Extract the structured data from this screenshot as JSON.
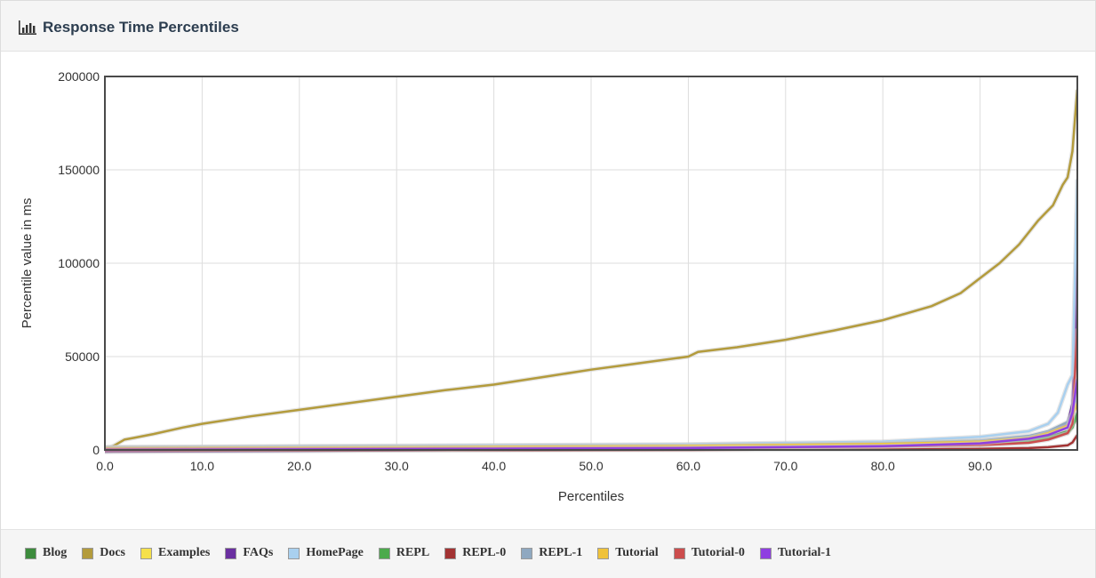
{
  "panel": {
    "title": "Response Time Percentiles",
    "icon": "bar-chart-icon"
  },
  "chart_data": {
    "type": "line",
    "xlabel": "Percentiles",
    "ylabel": "Percentile value in ms",
    "xlim": [
      0,
      100
    ],
    "ylim": [
      0,
      200000
    ],
    "x_ticks": [
      "0.0",
      "10.0",
      "20.0",
      "30.0",
      "40.0",
      "50.0",
      "60.0",
      "70.0",
      "80.0",
      "90.0"
    ],
    "y_ticks": [
      "0",
      "50000",
      "100000",
      "150000",
      "200000"
    ],
    "grid": true,
    "legend_position": "bottom",
    "series": [
      {
        "name": "Blog",
        "color": "#3d8b3d",
        "points": [
          [
            0,
            1000
          ],
          [
            20,
            1200
          ],
          [
            40,
            1500
          ],
          [
            60,
            1800
          ],
          [
            80,
            2500
          ],
          [
            90,
            3500
          ],
          [
            95,
            5000
          ],
          [
            97,
            7000
          ],
          [
            99,
            10000
          ],
          [
            99.5,
            13000
          ],
          [
            100,
            17000
          ]
        ]
      },
      {
        "name": "Docs",
        "color": "#b39b3c",
        "points": [
          [
            0,
            0
          ],
          [
            1,
            2500
          ],
          [
            2,
            5500
          ],
          [
            3,
            6500
          ],
          [
            5,
            8500
          ],
          [
            8,
            12000
          ],
          [
            10,
            14000
          ],
          [
            15,
            18000
          ],
          [
            20,
            21500
          ],
          [
            25,
            25000
          ],
          [
            30,
            28500
          ],
          [
            35,
            32000
          ],
          [
            40,
            35000
          ],
          [
            45,
            39000
          ],
          [
            50,
            43000
          ],
          [
            55,
            46500
          ],
          [
            60,
            50000
          ],
          [
            61,
            52500
          ],
          [
            65,
            55000
          ],
          [
            70,
            59000
          ],
          [
            75,
            64000
          ],
          [
            80,
            69500
          ],
          [
            85,
            77000
          ],
          [
            88,
            84000
          ],
          [
            90,
            92000
          ],
          [
            92,
            100000
          ],
          [
            94,
            110000
          ],
          [
            96,
            123000
          ],
          [
            97.5,
            131000
          ],
          [
            98.5,
            142000
          ],
          [
            99,
            146000
          ],
          [
            99.5,
            160000
          ],
          [
            99.8,
            180000
          ],
          [
            100,
            193000
          ]
        ]
      },
      {
        "name": "Examples",
        "color": "#f5e04a",
        "points": [
          [
            0,
            1500
          ],
          [
            20,
            1800
          ],
          [
            40,
            2200
          ],
          [
            60,
            2700
          ],
          [
            80,
            3800
          ],
          [
            90,
            5000
          ],
          [
            95,
            7000
          ],
          [
            97,
            9000
          ],
          [
            99,
            14000
          ],
          [
            99.5,
            20000
          ],
          [
            100,
            28000
          ]
        ]
      },
      {
        "name": "FAQs",
        "color": "#6a2fa0",
        "points": [
          [
            0,
            -1000
          ],
          [
            20,
            -500
          ],
          [
            40,
            0
          ],
          [
            60,
            500
          ],
          [
            70,
            1500
          ],
          [
            80,
            2500
          ],
          [
            90,
            4500
          ],
          [
            95,
            7000
          ],
          [
            97,
            9000
          ],
          [
            99,
            14000
          ],
          [
            99.5,
            25000
          ],
          [
            99.8,
            60000
          ],
          [
            100,
            127000
          ]
        ]
      },
      {
        "name": "HomePage",
        "color": "#a9d0ef",
        "points": [
          [
            0,
            1500
          ],
          [
            20,
            2000
          ],
          [
            40,
            2500
          ],
          [
            60,
            3000
          ],
          [
            80,
            4500
          ],
          [
            90,
            7000
          ],
          [
            95,
            10000
          ],
          [
            97,
            14000
          ],
          [
            98,
            20000
          ],
          [
            99,
            35000
          ],
          [
            99.5,
            40000
          ],
          [
            100,
            145000
          ]
        ]
      },
      {
        "name": "REPL",
        "color": "#4caa4c",
        "points": [
          [
            0,
            800
          ],
          [
            20,
            1000
          ],
          [
            40,
            1300
          ],
          [
            60,
            1600
          ],
          [
            80,
            2200
          ],
          [
            90,
            3000
          ],
          [
            95,
            4500
          ],
          [
            97,
            6000
          ],
          [
            99,
            9000
          ],
          [
            99.5,
            12000
          ],
          [
            100,
            20000
          ]
        ]
      },
      {
        "name": "REPL-0",
        "color": "#a33333",
        "points": [
          [
            0,
            -500
          ],
          [
            20,
            -300
          ],
          [
            40,
            -100
          ],
          [
            60,
            0
          ],
          [
            80,
            300
          ],
          [
            90,
            600
          ],
          [
            95,
            1000
          ],
          [
            97,
            1500
          ],
          [
            99,
            2500
          ],
          [
            99.5,
            4000
          ],
          [
            100,
            8000
          ]
        ]
      },
      {
        "name": "REPL-1",
        "color": "#8fa8c0",
        "points": [
          [
            0,
            1200
          ],
          [
            20,
            1500
          ],
          [
            40,
            1800
          ],
          [
            60,
            2300
          ],
          [
            80,
            3500
          ],
          [
            90,
            5000
          ],
          [
            95,
            7500
          ],
          [
            97,
            10000
          ],
          [
            99,
            15000
          ],
          [
            99.5,
            20000
          ],
          [
            100,
            30000
          ]
        ]
      },
      {
        "name": "Tutorial",
        "color": "#efc23a",
        "points": [
          [
            0,
            1000
          ],
          [
            20,
            1300
          ],
          [
            40,
            1700
          ],
          [
            60,
            2200
          ],
          [
            80,
            3200
          ],
          [
            90,
            4500
          ],
          [
            95,
            6500
          ],
          [
            97,
            9000
          ],
          [
            99,
            13000
          ],
          [
            99.5,
            18000
          ],
          [
            100,
            25000
          ]
        ]
      },
      {
        "name": "Tutorial-0",
        "color": "#cc4d4d",
        "points": [
          [
            0,
            500
          ],
          [
            20,
            700
          ],
          [
            40,
            900
          ],
          [
            60,
            1200
          ],
          [
            80,
            1800
          ],
          [
            90,
            2600
          ],
          [
            95,
            3800
          ],
          [
            97,
            5500
          ],
          [
            99,
            9000
          ],
          [
            99.5,
            14000
          ],
          [
            100,
            65000
          ]
        ]
      },
      {
        "name": "Tutorial-1",
        "color": "#8f3fe0",
        "points": [
          [
            0,
            0
          ],
          [
            20,
            300
          ],
          [
            40,
            600
          ],
          [
            60,
            1000
          ],
          [
            80,
            2000
          ],
          [
            90,
            3500
          ],
          [
            95,
            6000
          ],
          [
            97,
            8000
          ],
          [
            99,
            12000
          ],
          [
            99.5,
            20000
          ],
          [
            100,
            38000
          ]
        ]
      }
    ]
  }
}
